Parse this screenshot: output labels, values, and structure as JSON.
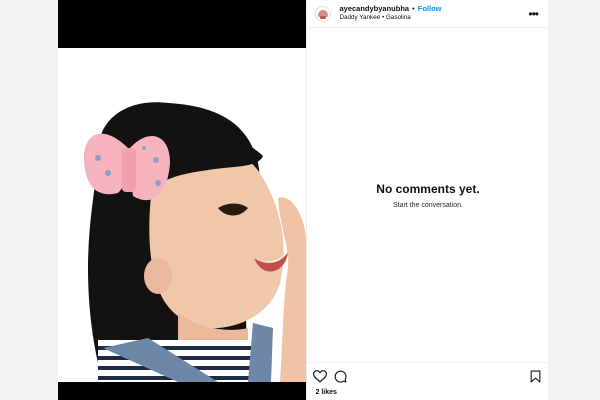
{
  "header": {
    "username": "ayecandybyanubha",
    "separator": "•",
    "follow_label": "Follow",
    "audio": "Daddy Yankee • Gasolina",
    "more_icon": "ellipsis-icon"
  },
  "comments": {
    "title": "No comments yet.",
    "subtitle": "Start the conversation."
  },
  "actions": {
    "like_icon": "heart-icon",
    "comment_icon": "comment-icon",
    "save_icon": "bookmark-icon"
  },
  "likes_text": "2 likes",
  "colors": {
    "follow": "#0095f6",
    "page_background": "#f2f2f2",
    "divider": "#efefef"
  }
}
